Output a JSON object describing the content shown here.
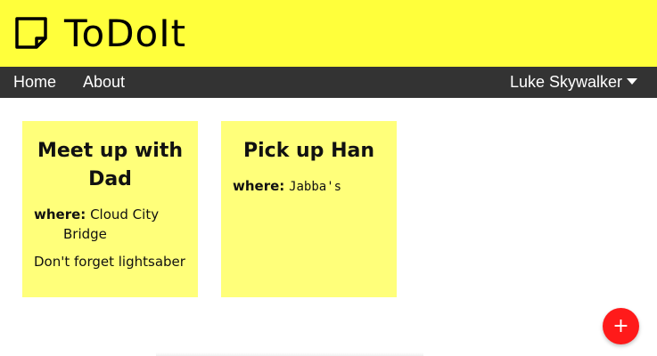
{
  "app": {
    "title": "ToDoIt"
  },
  "nav": {
    "home_label": "Home",
    "about_label": "About",
    "user_name": "Luke Skywalker"
  },
  "notes": [
    {
      "title": "Meet up with Dad",
      "where_label": "where:",
      "where_value": "Cloud City Bridge",
      "description": "Don't forget lightsaber"
    },
    {
      "title": "Pick up Han",
      "where_label": "where:",
      "where_value": "Jabba's",
      "description": ""
    }
  ],
  "fab": {
    "label": "+"
  },
  "colors": {
    "header_bg": "#ffff3b",
    "navbar_bg": "#333333",
    "note_bg": "#ffff7a",
    "fab_bg": "#ff1a1a"
  },
  "icons": {
    "logo": "sticky-note-icon",
    "user_menu": "caret-down-icon",
    "fab": "plus-icon"
  }
}
